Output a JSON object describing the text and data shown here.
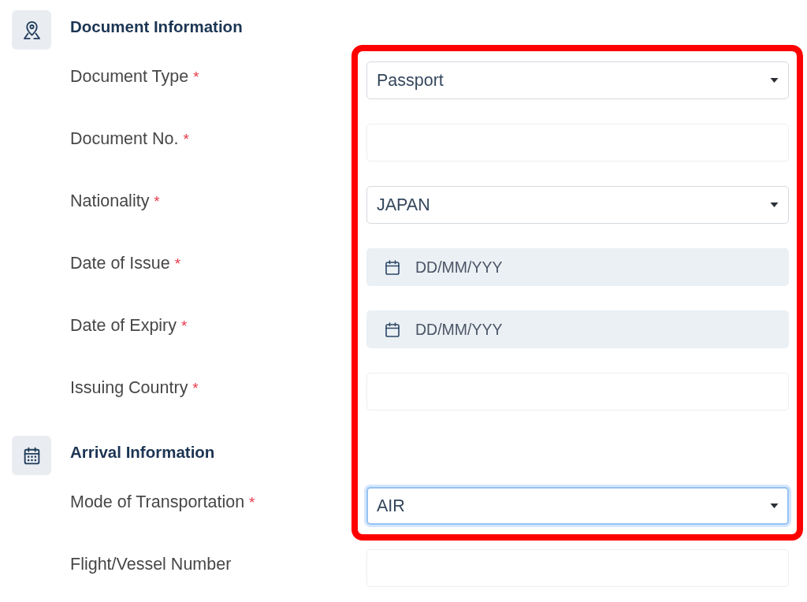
{
  "sections": [
    {
      "title": "Document Information",
      "fields": [
        {
          "label": "Document Type",
          "required_mark": "*",
          "kind": "select",
          "value": "Passport",
          "focused": false
        },
        {
          "label": "Document No.",
          "required_mark": "*",
          "kind": "text",
          "focused": false
        },
        {
          "label": "Nationality",
          "required_mark": "*",
          "kind": "select",
          "value": "JAPAN",
          "focused": false
        },
        {
          "label": "Date of Issue",
          "required_mark": "*",
          "kind": "date",
          "placeholder": "DD/MM/YYY",
          "focused": false
        },
        {
          "label": "Date of Expiry",
          "required_mark": "*",
          "kind": "date",
          "placeholder": "DD/MM/YYY",
          "focused": false
        },
        {
          "label": "Issuing Country",
          "required_mark": "*",
          "kind": "text",
          "focused": false
        }
      ]
    },
    {
      "title": "Arrival Information",
      "fields": [
        {
          "label": "Mode of Transportation",
          "required_mark": "*",
          "kind": "select",
          "value": "AIR",
          "focused": true
        },
        {
          "label": "Flight/Vessel Number",
          "kind": "text",
          "focused": false
        }
      ]
    }
  ]
}
